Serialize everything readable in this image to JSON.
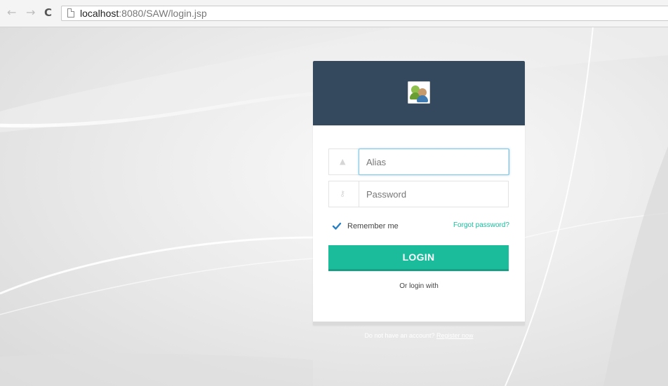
{
  "browser": {
    "back_icon": "arrow-left-icon",
    "forward_icon": "arrow-right-icon",
    "reload_icon": "reload-icon",
    "url_host": "localhost",
    "url_rest": ":8080/SAW/login.jsp"
  },
  "login": {
    "alias_placeholder": "Alias",
    "password_placeholder": "Password",
    "remember_label": "Remember me",
    "remember_checked": true,
    "forgot_label": "Forgot password?",
    "login_button": "LOGIN",
    "or_login_with": "Or login with",
    "register_prompt": "Do not have an account?",
    "register_link": "Register now"
  },
  "colors": {
    "header": "#34495e",
    "accent": "#1abc9c"
  }
}
